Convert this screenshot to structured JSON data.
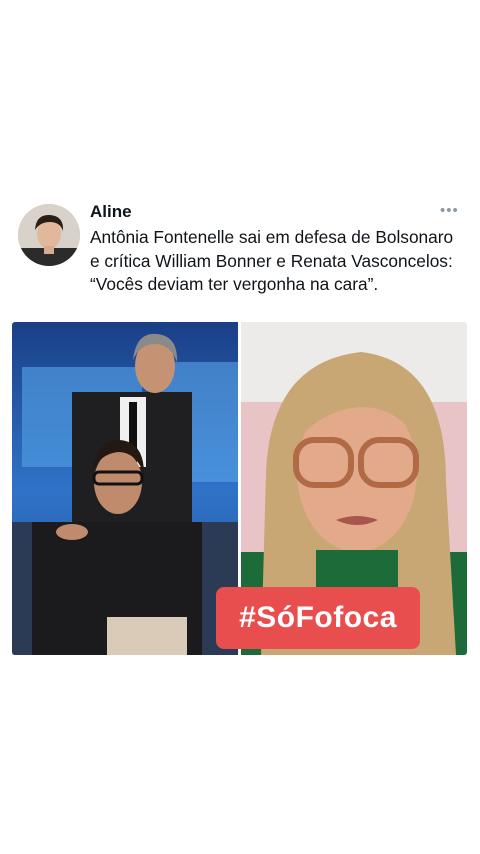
{
  "tweet": {
    "author": "Aline",
    "more_icon": "ellipsis-icon",
    "text": "Antônia Fontenelle sai em defesa de Bolsonaro e crítica William Bonner e Renata Vasconcelos: “Vocês deviam ter vergonha na cara”.",
    "overlay_tag": "#SóFofoca"
  },
  "colors": {
    "tag_bg": "#e94e4e",
    "text": "#0f1419",
    "muted": "#8b98a5"
  }
}
